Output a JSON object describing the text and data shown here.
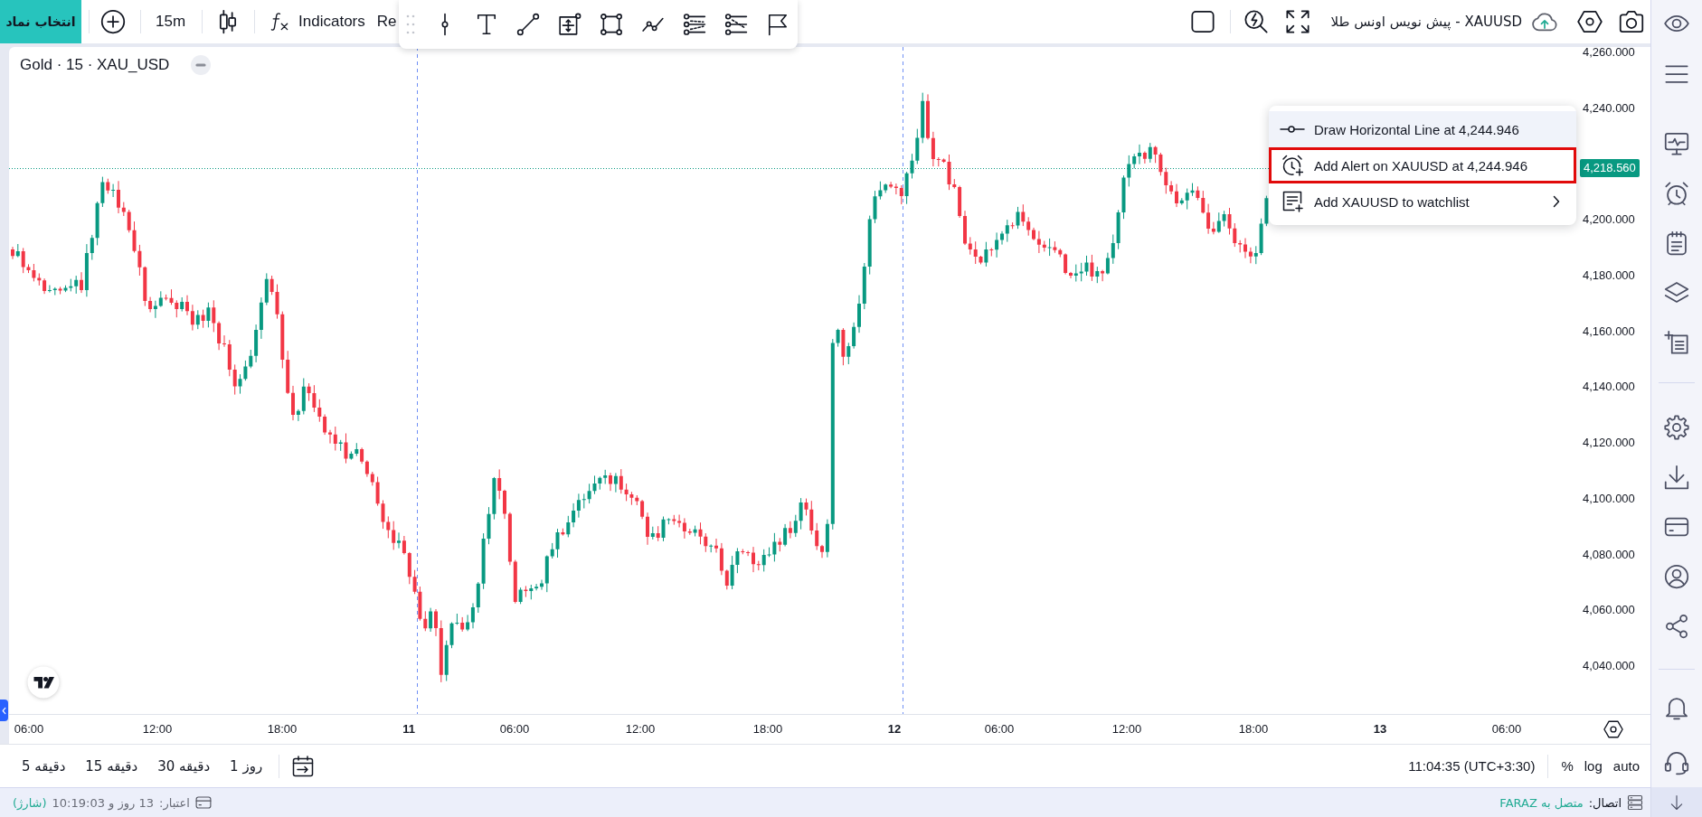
{
  "top_bar": {
    "symbol_button": "انتخاب نماد",
    "interval": "15m",
    "indicators": "Indicators",
    "partial_button": "Re",
    "layout_title": "XAUUSD - پیش نویس اونس طلا"
  },
  "legend": {
    "title": "Gold · 15 · XAU_USD"
  },
  "price_axis": {
    "labels": [
      "4,260.000",
      "4,240.000",
      "4,200.000",
      "4,180.000",
      "4,160.000",
      "4,140.000",
      "4,120.000",
      "4,100.000",
      "4,080.000",
      "4,060.000",
      "4,040.000"
    ],
    "current_price": "4,218.560"
  },
  "time_axis": {
    "labels": [
      {
        "text": "06:00",
        "kind": "time"
      },
      {
        "text": "12:00",
        "kind": "time"
      },
      {
        "text": "18:00",
        "kind": "time"
      },
      {
        "text": "11",
        "kind": "day"
      },
      {
        "text": "06:00",
        "kind": "time"
      },
      {
        "text": "12:00",
        "kind": "time"
      },
      {
        "text": "18:00",
        "kind": "time"
      },
      {
        "text": "12",
        "kind": "day"
      },
      {
        "text": "06:00",
        "kind": "time"
      },
      {
        "text": "12:00",
        "kind": "time"
      },
      {
        "text": "18:00",
        "kind": "time"
      },
      {
        "text": "13",
        "kind": "day"
      },
      {
        "text": "06:00",
        "kind": "time"
      }
    ]
  },
  "context_menu": {
    "items": [
      {
        "kind": "horizontal-line",
        "label": "Draw Horizontal Line at 4,244.946",
        "hovered": true,
        "highlighted": false,
        "submenu": false
      },
      {
        "kind": "alert",
        "label": "Add Alert on XAUUSD at 4,244.946",
        "hovered": false,
        "highlighted": true,
        "submenu": false
      },
      {
        "kind": "watchlist",
        "label": "Add XAUUSD to watchlist",
        "hovered": false,
        "highlighted": false,
        "submenu": true
      }
    ]
  },
  "bottom_toolbar": {
    "intervals": [
      "1 روز",
      "30 دقیقه",
      "15 دقیقه",
      "5 دقیقه"
    ],
    "clock": "11:04:35 (UTC+3:30)",
    "scale_options": [
      "%",
      "log",
      "auto"
    ]
  },
  "status_bar": {
    "credit_label": "اعتبار:",
    "credit_value": "13 روز و 10:19:03",
    "recharge_link": "(شارژ)",
    "connection_label": "اتصال:",
    "connection_value": "متصل به FARAZ"
  }
}
